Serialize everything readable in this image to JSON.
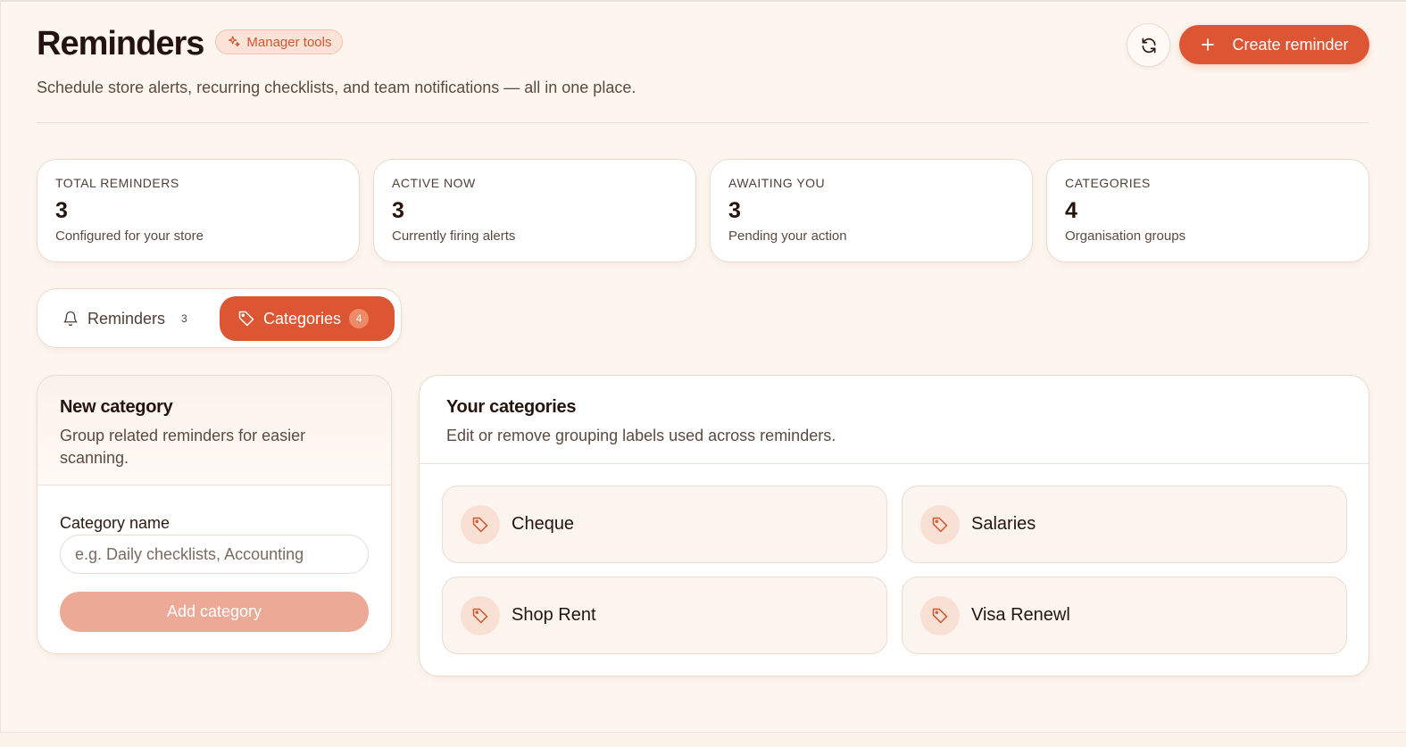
{
  "header": {
    "title": "Reminders",
    "badge": "Manager tools",
    "subtitle": "Schedule store alerts, recurring checklists, and team notifications — all in one place.",
    "create_label": "Create reminder"
  },
  "stats": [
    {
      "label": "TOTAL REMINDERS",
      "value": "3",
      "desc": "Configured for your store"
    },
    {
      "label": "ACTIVE NOW",
      "value": "3",
      "desc": "Currently firing alerts"
    },
    {
      "label": "AWAITING YOU",
      "value": "3",
      "desc": "Pending your action"
    },
    {
      "label": "CATEGORIES",
      "value": "4",
      "desc": "Organisation groups"
    }
  ],
  "tabs": {
    "reminders_label": "Reminders",
    "reminders_count": "3",
    "categories_label": "Categories",
    "categories_count": "4",
    "active": "categories"
  },
  "new_category": {
    "title": "New category",
    "subtitle": "Group related reminders for easier scanning.",
    "field_label": "Category name",
    "placeholder": "e.g. Daily checklists, Accounting",
    "value": "",
    "button": "Add category"
  },
  "your_categories": {
    "title": "Your categories",
    "subtitle": "Edit or remove grouping labels used across reminders.",
    "items": [
      {
        "name": "Cheque",
        "icon": "tag-icon"
      },
      {
        "name": "Salaries",
        "icon": "tag-icon"
      },
      {
        "name": "Shop Rent",
        "icon": "tag-icon"
      },
      {
        "name": "Visa Renewl",
        "icon": "tag-icon"
      }
    ]
  },
  "colors": {
    "accent": "#dc5634",
    "background": "#fdf6ef",
    "accent_soft": "#eca996"
  }
}
